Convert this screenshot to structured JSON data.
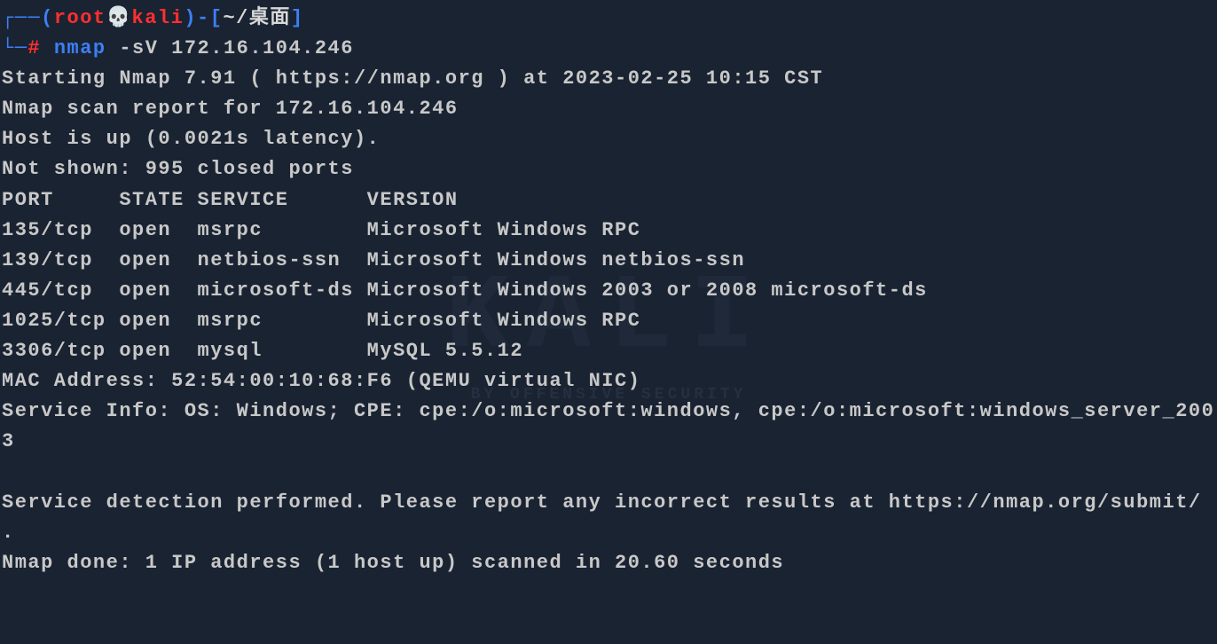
{
  "prompt": {
    "connector1": "┌──",
    "paren_open": "(",
    "user": "root",
    "skull": "💀",
    "host": "kali",
    "paren_close": ")",
    "dash": "-",
    "bracket_open": "[",
    "cwd": "~/桌面",
    "bracket_close": "]",
    "connector2": "└─",
    "hash": "#",
    "command": "nmap",
    "args": " -sV 172.16.104.246"
  },
  "output": {
    "starting": "Starting Nmap 7.91 ( https://nmap.org ) at 2023-02-25 10:15 CST",
    "report": "Nmap scan report for 172.16.104.246",
    "host_up": "Host is up (0.0021s latency).",
    "not_shown": "Not shown: 995 closed ports",
    "header": "PORT     STATE SERVICE      VERSION",
    "ports": [
      {
        "line": "135/tcp  open  msrpc        Microsoft Windows RPC"
      },
      {
        "line": "139/tcp  open  netbios-ssn  Microsoft Windows netbios-ssn"
      },
      {
        "line": "445/tcp  open  microsoft-ds Microsoft Windows 2003 or 2008 microsoft-ds"
      },
      {
        "line": "1025/tcp open  msrpc        Microsoft Windows RPC"
      },
      {
        "line": "3306/tcp open  mysql        MySQL 5.5.12"
      }
    ],
    "mac": "MAC Address: 52:54:00:10:68:F6 (QEMU virtual NIC)",
    "service_info": "Service Info: OS: Windows; CPE: cpe:/o:microsoft:windows, cpe:/o:microsoft:windows_server_2003",
    "blank": " ",
    "detection": "Service detection performed. Please report any incorrect results at https://nmap.org/submit/ .",
    "done": "Nmap done: 1 IP address (1 host up) scanned in 20.60 seconds"
  },
  "watermark": {
    "main": "KALI",
    "sub": "BY OFFENSIVE SECURITY"
  }
}
